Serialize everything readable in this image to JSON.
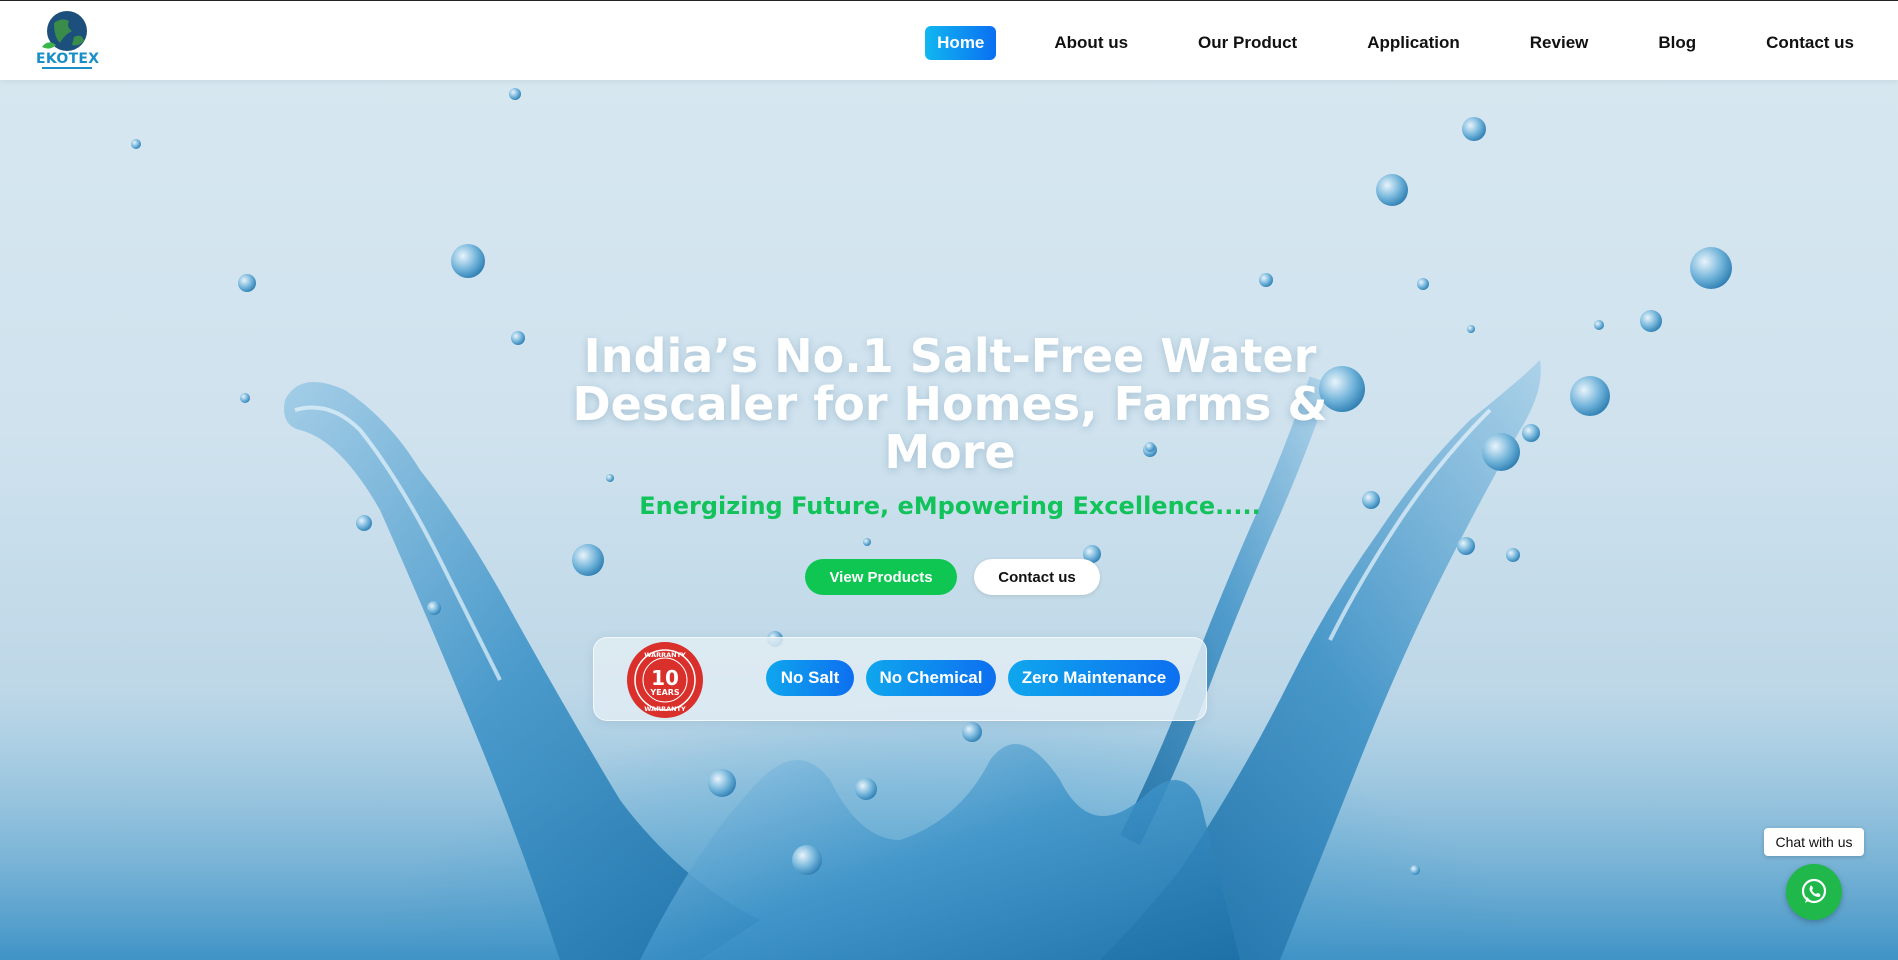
{
  "brand": {
    "name": "EKOTEX",
    "logo_icon": "globe-leaf-icon"
  },
  "nav": {
    "items": [
      {
        "label": "Home",
        "active": true
      },
      {
        "label": "About us"
      },
      {
        "label": "Our Product"
      },
      {
        "label": "Application"
      },
      {
        "label": "Review"
      },
      {
        "label": "Blog"
      },
      {
        "label": "Contact us"
      }
    ]
  },
  "hero": {
    "title_line1": "India’s No.1 Salt-Free Water",
    "title_line2": "Descaler for Homes, Farms &",
    "title_line3": "More",
    "subtitle": "Energizing Future, eMpowering Excellence.....",
    "primary_button": "View Products",
    "secondary_button": "Contact us"
  },
  "features": {
    "badge": {
      "top": "WARRANTY",
      "number": "10",
      "unit": "YEARS",
      "bottom": "WARRANTY"
    },
    "pills": [
      "No Salt",
      "No Chemical",
      "Zero Maintenance"
    ]
  },
  "chat": {
    "label": "Chat with us",
    "icon": "whatsapp-icon"
  },
  "colors": {
    "accent_blue": "#0d6ff0",
    "accent_green": "#0fc653",
    "subtitle_green": "#12c25a",
    "whatsapp_green": "#20b84b",
    "seal_red": "#d9302c"
  }
}
